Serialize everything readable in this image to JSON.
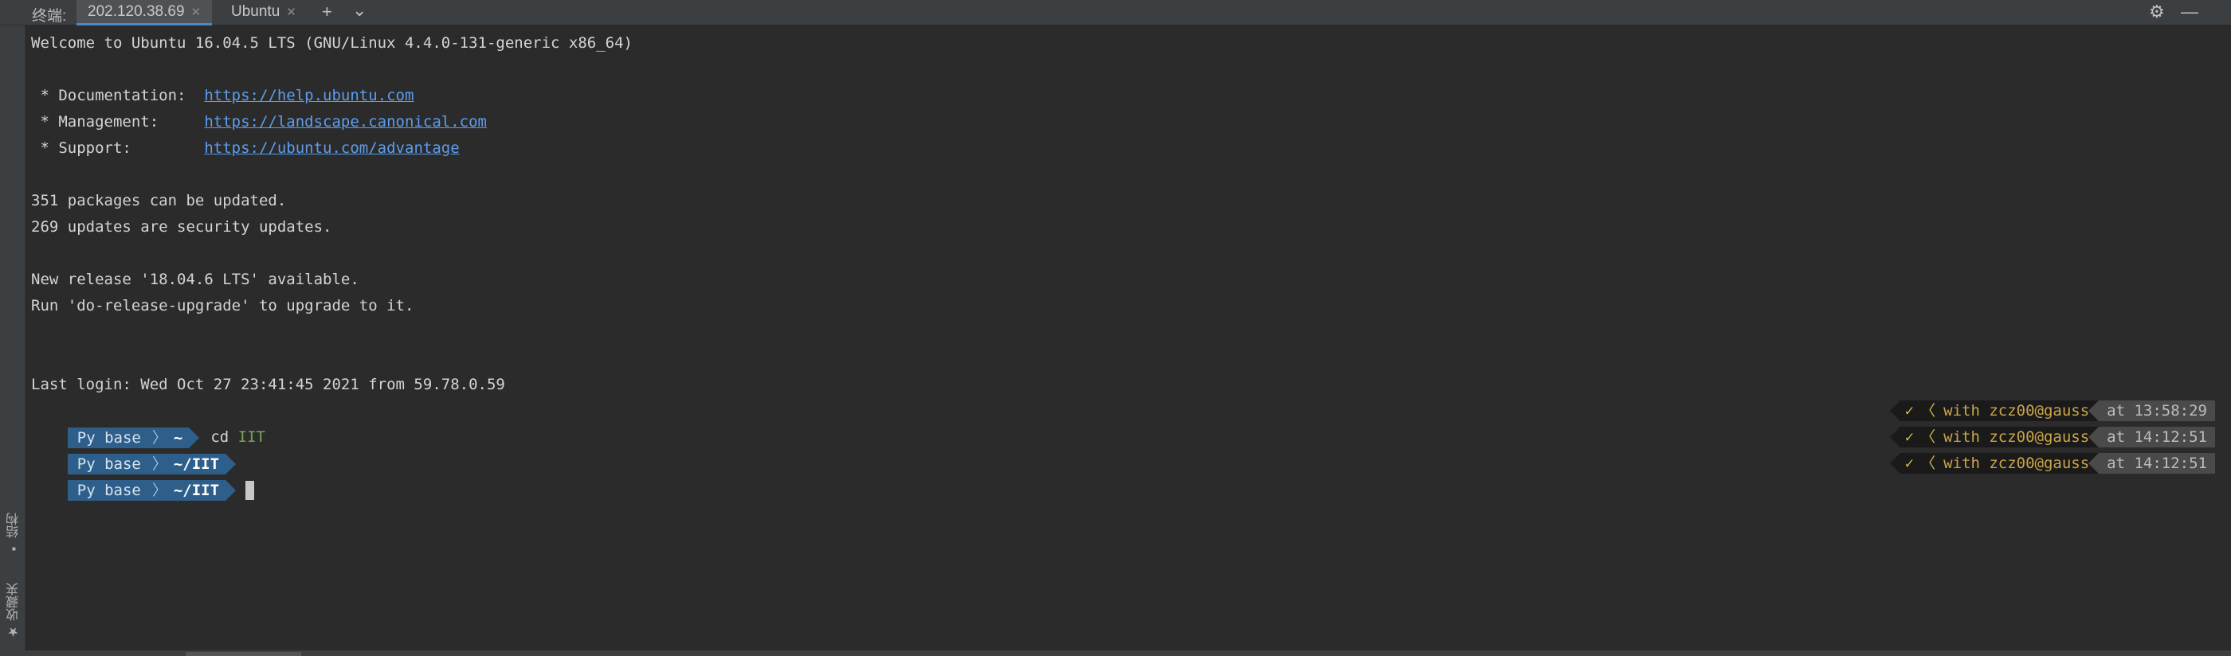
{
  "tabbar": {
    "label": "终端:",
    "tabs": [
      {
        "label": "202.120.38.69",
        "active": true
      },
      {
        "label": "Ubuntu",
        "active": false
      }
    ],
    "add_icon": "plus-icon",
    "dropdown_icon": "chevron-down-icon",
    "settings_icon": "gear-icon",
    "minimize_icon": "minimize-icon"
  },
  "sidebar": {
    "items": [
      {
        "label": "结构",
        "icon": "structure-icon"
      },
      {
        "label": "收藏夹",
        "icon": "star-icon"
      }
    ]
  },
  "terminal": {
    "welcome": "Welcome to Ubuntu 16.04.5 LTS (GNU/Linux 4.4.0-131-generic x86_64)",
    "links": [
      {
        "label": " * Documentation:  ",
        "url": "https://help.ubuntu.com"
      },
      {
        "label": " * Management:     ",
        "url": "https://landscape.canonical.com"
      },
      {
        "label": " * Support:        ",
        "url": "https://ubuntu.com/advantage"
      }
    ],
    "updates": [
      "351 packages can be updated.",
      "269 updates are security updates."
    ],
    "release": [
      "New release '18.04.6 LTS' available.",
      "Run 'do-release-upgrade' to upgrade to it."
    ],
    "last_login": "Last login: Wed Oct 27 23:41:45 2021 from 59.78.0.59",
    "prompts": [
      {
        "env": "Py base",
        "dir": "~",
        "command": "cd",
        "arg": "IIT",
        "check": "✓",
        "user": "with zcz00@gauss",
        "time": "at 13:58:29"
      },
      {
        "env": "Py base",
        "dir": "~/IIT",
        "command": "",
        "arg": "",
        "check": "✓",
        "user": "with zcz00@gauss",
        "time": "at 14:12:51"
      },
      {
        "env": "Py base",
        "dir": "~/IIT",
        "command": "",
        "arg": "",
        "check": "✓",
        "user": "with zcz00@gauss",
        "time": "at 14:12:51"
      }
    ]
  }
}
